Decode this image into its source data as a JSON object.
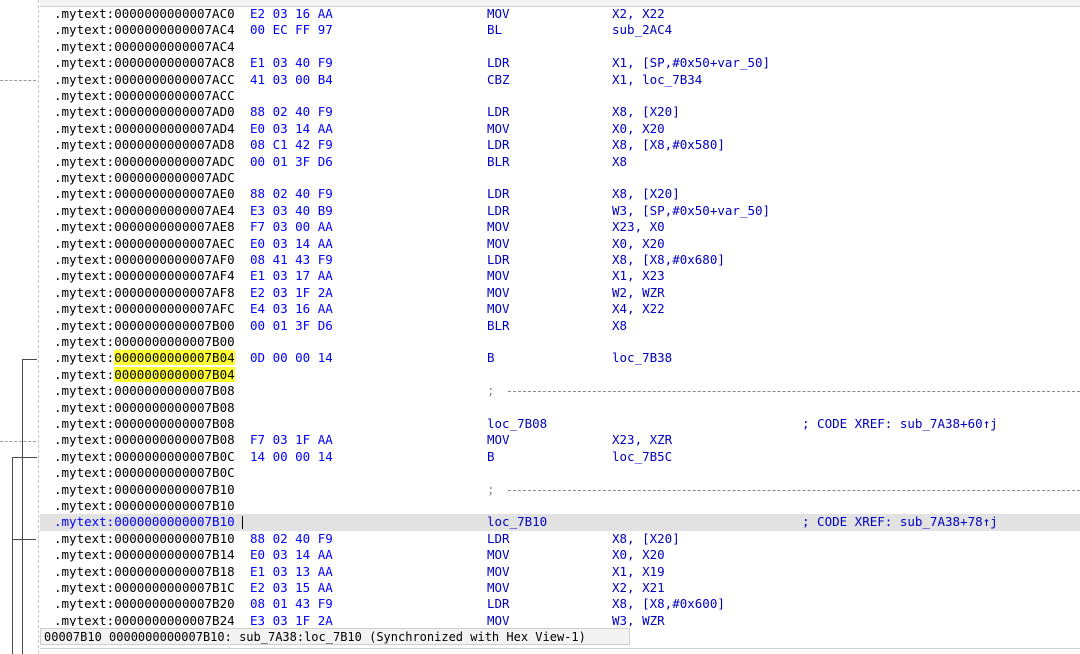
{
  "status_bar": {
    "text": "00007B10 0000000000007B10: sub_7A38:loc_7B10 (Synchronized with Hex View-1)"
  },
  "listing": {
    "rows": [
      {
        "seg": ".mytext:",
        "addr": "0000000000007AC0",
        "bytes": "E2 03 16 AA",
        "mnem": "MOV",
        "ops": "X2, X22",
        "dot": true
      },
      {
        "seg": ".mytext:",
        "addr": "0000000000007AC4",
        "bytes": "00 EC FF 97",
        "mnem": "BL",
        "ops": "sub_2AC4",
        "dot": true
      },
      {
        "seg": ".mytext:",
        "addr": "0000000000007AC4"
      },
      {
        "seg": ".mytext:",
        "addr": "0000000000007AC8",
        "bytes": "E1 03 40 F9",
        "mnem": "LDR",
        "ops": "X1, [SP,#0x50+var_50]",
        "dot": true
      },
      {
        "seg": ".mytext:",
        "addr": "0000000000007ACC",
        "bytes": "41 03 00 B4",
        "mnem": "CBZ",
        "ops": "X1, loc_7B34",
        "dot": true
      },
      {
        "seg": ".mytext:",
        "addr": "0000000000007ACC"
      },
      {
        "seg": ".mytext:",
        "addr": "0000000000007AD0",
        "bytes": "88 02 40 F9",
        "mnem": "LDR",
        "ops": "X8, [X20]",
        "dot": true
      },
      {
        "seg": ".mytext:",
        "addr": "0000000000007AD4",
        "bytes": "E0 03 14 AA",
        "mnem": "MOV",
        "ops": "X0, X20",
        "dot": true
      },
      {
        "seg": ".mytext:",
        "addr": "0000000000007AD8",
        "bytes": "08 C1 42 F9",
        "mnem": "LDR",
        "ops": "X8, [X8,#0x580]",
        "dot": true
      },
      {
        "seg": ".mytext:",
        "addr": "0000000000007ADC",
        "bytes": "00 01 3F D6",
        "mnem": "BLR",
        "ops": "X8",
        "dot": true
      },
      {
        "seg": ".mytext:",
        "addr": "0000000000007ADC"
      },
      {
        "seg": ".mytext:",
        "addr": "0000000000007AE0",
        "bytes": "88 02 40 F9",
        "mnem": "LDR",
        "ops": "X8, [X20]",
        "dot": true
      },
      {
        "seg": ".mytext:",
        "addr": "0000000000007AE4",
        "bytes": "E3 03 40 B9",
        "mnem": "LDR",
        "ops": "W3, [SP,#0x50+var_50]",
        "dot": true
      },
      {
        "seg": ".mytext:",
        "addr": "0000000000007AE8",
        "bytes": "F7 03 00 AA",
        "mnem": "MOV",
        "ops": "X23, X0",
        "dot": true
      },
      {
        "seg": ".mytext:",
        "addr": "0000000000007AEC",
        "bytes": "E0 03 14 AA",
        "mnem": "MOV",
        "ops": "X0, X20",
        "dot": true
      },
      {
        "seg": ".mytext:",
        "addr": "0000000000007AF0",
        "bytes": "08 41 43 F9",
        "mnem": "LDR",
        "ops": "X8, [X8,#0x680]",
        "dot": true
      },
      {
        "seg": ".mytext:",
        "addr": "0000000000007AF4",
        "bytes": "E1 03 17 AA",
        "mnem": "MOV",
        "ops": "X1, X23",
        "dot": true
      },
      {
        "seg": ".mytext:",
        "addr": "0000000000007AF8",
        "bytes": "E2 03 1F 2A",
        "mnem": "MOV",
        "ops": "W2, WZR",
        "dot": true
      },
      {
        "seg": ".mytext:",
        "addr": "0000000000007AFC",
        "bytes": "E4 03 16 AA",
        "mnem": "MOV",
        "ops": "X4, X22",
        "dot": true
      },
      {
        "seg": ".mytext:",
        "addr": "0000000000007B00",
        "bytes": "00 01 3F D6",
        "mnem": "BLR",
        "ops": "X8",
        "dot": true
      },
      {
        "seg": ".mytext:",
        "addr": "0000000000007B00"
      },
      {
        "seg": ".mytext:",
        "addr": "0000000000007B04",
        "bytes": "0D 00 00 14",
        "mnem": "B",
        "ops": "loc_7B38",
        "dot": true,
        "hl": true
      },
      {
        "seg": ".mytext:",
        "addr": "0000000000007B04",
        "hl": true
      },
      {
        "seg": ".mytext:",
        "addr": "0000000000007B08",
        "sep": ";"
      },
      {
        "seg": ".mytext:",
        "addr": "0000000000007B08"
      },
      {
        "seg": ".mytext:",
        "addr": "0000000000007B08",
        "label": "loc_7B08",
        "comment": "; CODE XREF: sub_7A38+60↑j"
      },
      {
        "seg": ".mytext:",
        "addr": "0000000000007B08",
        "bytes": "F7 03 1F AA",
        "mnem": "MOV",
        "ops": "X23, XZR",
        "dot": true
      },
      {
        "seg": ".mytext:",
        "addr": "0000000000007B0C",
        "bytes": "14 00 00 14",
        "mnem": "B",
        "ops": "loc_7B5C",
        "dot": true
      },
      {
        "seg": ".mytext:",
        "addr": "0000000000007B0C"
      },
      {
        "seg": ".mytext:",
        "addr": "0000000000007B10",
        "sep": ";"
      },
      {
        "seg": ".mytext:",
        "addr": "0000000000007B10"
      },
      {
        "seg": ".mytext:",
        "addr": "0000000000007B10",
        "label": "loc_7B10",
        "comment": "; CODE XREF: sub_7A38+78↑j",
        "selected": true
      },
      {
        "seg": ".mytext:",
        "addr": "0000000000007B10",
        "bytes": "88 02 40 F9",
        "mnem": "LDR",
        "ops": "X8, [X20]",
        "dot": true
      },
      {
        "seg": ".mytext:",
        "addr": "0000000000007B14",
        "bytes": "E0 03 14 AA",
        "mnem": "MOV",
        "ops": "X0, X20",
        "dot": true
      },
      {
        "seg": ".mytext:",
        "addr": "0000000000007B18",
        "bytes": "E1 03 13 AA",
        "mnem": "MOV",
        "ops": "X1, X19",
        "dot": true
      },
      {
        "seg": ".mytext:",
        "addr": "0000000000007B1C",
        "bytes": "E2 03 15 AA",
        "mnem": "MOV",
        "ops": "X2, X21",
        "dot": true
      },
      {
        "seg": ".mytext:",
        "addr": "0000000000007B20",
        "bytes": "08 01 43 F9",
        "mnem": "LDR",
        "ops": "X8, [X8,#0x600]",
        "dot": true
      },
      {
        "seg": ".mytext:",
        "addr": "0000000000007B24",
        "bytes": "E3 03 1F 2A",
        "mnem": "MOV",
        "ops": "W3, WZR",
        "dot": true
      }
    ]
  }
}
